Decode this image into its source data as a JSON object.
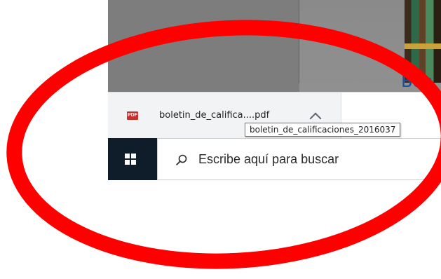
{
  "page": {
    "banner_text_fragment": "Boc"
  },
  "download_bar": {
    "item": {
      "icon_label": "PDF",
      "icon_name": "pdf-file-icon",
      "filename": "boletin_de_califica....pdf",
      "menu_icon": "chevron-up-icon"
    },
    "tooltip": "boletin_de_calificaciones_2016037"
  },
  "taskbar": {
    "start_icon": "windows-icon",
    "search": {
      "icon": "search-icon",
      "placeholder": "Escribe aquí para buscar"
    }
  },
  "annotation": {
    "shape": "ellipse",
    "color": "#ff0000"
  },
  "colors": {
    "taskbar_start": "#0f1c2a",
    "download_item_bg": "#f1f3f4",
    "pdf_icon": "#c9302c",
    "banner_text": "#1e4f9a"
  }
}
